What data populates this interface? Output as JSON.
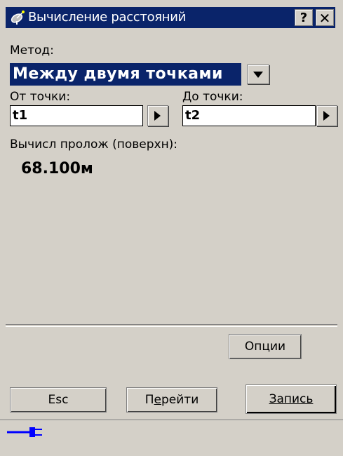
{
  "window": {
    "title": "Вычисление расстояний",
    "help_label": "?",
    "close_label": "✕"
  },
  "method": {
    "label": "Метод:",
    "value": "Между двумя точками"
  },
  "from_point": {
    "label": "От точки:",
    "value": "t1"
  },
  "to_point": {
    "label": "До точки:",
    "value": "t2"
  },
  "result": {
    "label": "Вычисл пролож (поверхн):",
    "value": "68.100м"
  },
  "buttons": {
    "options": "Опции",
    "esc": "Esc",
    "goto_prefix": "П",
    "goto_underlined": "е",
    "goto_suffix": "рейти",
    "save": "Запись"
  },
  "icons": {
    "title_icon": "satellite-dish-icon",
    "status_icon": "power-plug-icon"
  },
  "colors": {
    "titlebar": "#0a246a",
    "selection": "#0a246a",
    "window_bg": "#d4d0c8",
    "plug": "#0000ff"
  }
}
